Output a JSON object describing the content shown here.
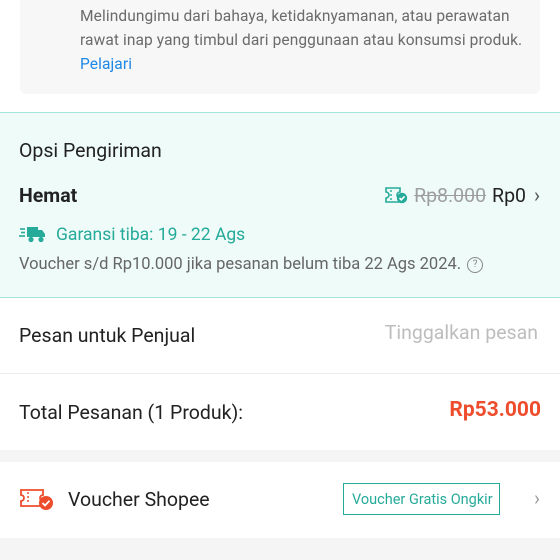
{
  "protection": {
    "text": "Melindungimu dari bahaya, ketidaknyamanan, atau perawatan rawat inap yang timbul dari penggunaan atau konsumsi produk.",
    "link": "Pelajari"
  },
  "shipping": {
    "section_title": "Opsi Pengiriman",
    "option_name": "Hemat",
    "original_price": "Rp8.000",
    "final_price": "Rp0",
    "guarantee": "Garansi tiba: 19 - 22 Ags",
    "voucher_note": "Voucher s/d  Rp10.000 jika pesanan belum tiba 22 Ags 2024.",
    "accent_color": "#26aa99"
  },
  "message": {
    "label": "Pesan untuk Penjual",
    "placeholder": "Tinggalkan pesan",
    "value": ""
  },
  "total": {
    "label": "Total Pesanan (1 Produk):",
    "amount": "Rp53.000",
    "amount_color": "#ee4d2d"
  },
  "voucher": {
    "label": "Voucher Shopee",
    "tag": "Voucher Gratis Ongkir"
  },
  "icons": {
    "shipping_voucher": "ticket-check-icon",
    "truck": "fast-truck-icon",
    "help": "help-circle-icon",
    "voucher": "voucher-ticket-icon",
    "chevron": "chevron-right-icon"
  }
}
